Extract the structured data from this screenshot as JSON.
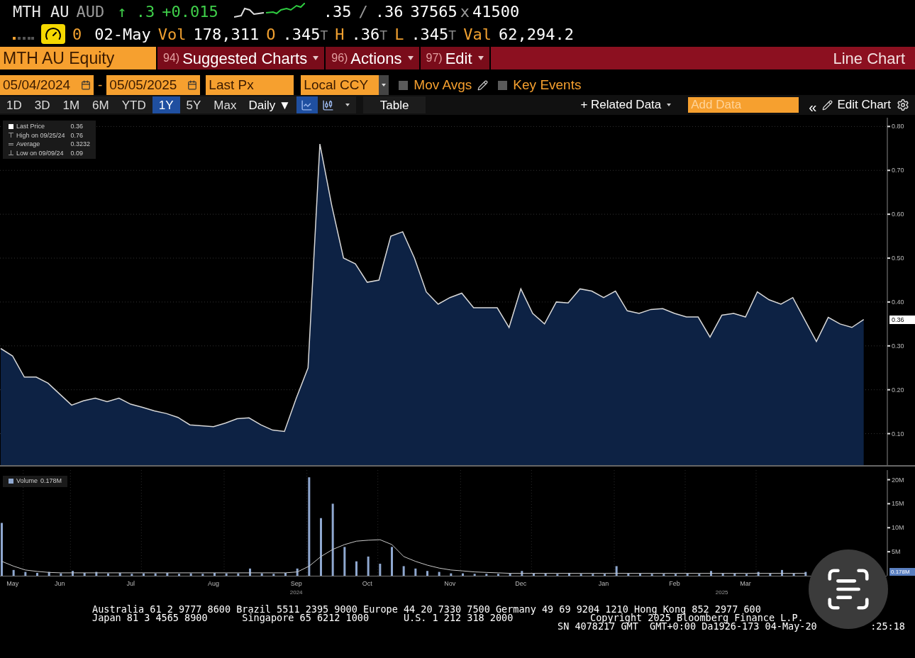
{
  "quote": {
    "ticker": "MTH AU",
    "currency": "AUD",
    "change": "↑ .3",
    "change_abs": "+0.015",
    "bid": ".35",
    "separator": "/",
    "ask": ".36",
    "bid_size": "37565",
    "size_separator": "x",
    "ask_size": "41500"
  },
  "session": {
    "count": "0",
    "date": "02-May",
    "stats": [
      {
        "label": "Vol",
        "value": "178,311"
      },
      {
        "label": "O",
        "value": ".345",
        "suffix": "T"
      },
      {
        "label": "H",
        "value": ".36",
        "suffix": "T"
      },
      {
        "label": "L",
        "value": ".345",
        "suffix": "T"
      },
      {
        "label": "Val",
        "value": "62,294.2"
      }
    ]
  },
  "command_bar": {
    "security": "MTH AU Equity",
    "menus": [
      {
        "number": "94)",
        "label": "Suggested Charts"
      },
      {
        "number": "96)",
        "label": "Actions"
      },
      {
        "number": "97)",
        "label": "Edit"
      }
    ],
    "title": "Line Chart"
  },
  "settings": {
    "start_date": "05/04/2024",
    "separator": "-",
    "end_date": "05/05/2025",
    "field": "Last Px",
    "currency": "Local CCY",
    "toggles": [
      {
        "label": "Mov Avgs",
        "checked": false,
        "editable": true
      },
      {
        "label": "Key Events",
        "checked": false,
        "editable": false
      }
    ]
  },
  "toolbar": {
    "periods": [
      {
        "label": "1D",
        "selected": false
      },
      {
        "label": "3D",
        "selected": false
      },
      {
        "label": "1M",
        "selected": false
      },
      {
        "label": "6M",
        "selected": false
      },
      {
        "label": "YTD",
        "selected": false
      },
      {
        "label": "1Y",
        "selected": true
      },
      {
        "label": "5Y",
        "selected": false
      },
      {
        "label": "Max",
        "selected": false
      }
    ],
    "frequency": "Daily ▼",
    "chart_types": [
      {
        "kind": "line",
        "selected": true
      },
      {
        "kind": "bars",
        "selected": false
      }
    ],
    "table": "Table",
    "related_data": "+ Related Data",
    "add_data_placeholder": "Add Data",
    "collapse": "«",
    "edit_chart": "Edit Chart"
  },
  "price_chart": {
    "legend": [
      {
        "kind": "last",
        "value": "0.36"
      },
      {
        "kind": "high",
        "label": "High on 09/25/24",
        "value": "0.76"
      },
      {
        "kind": "average",
        "label": "Average",
        "value": "0.3232"
      },
      {
        "kind": "low",
        "label": "Low on 09/09/24",
        "value": "0.09"
      }
    ],
    "last_tag": "0.36",
    "chart_data": {
      "type": "area",
      "grid": true,
      "ylim": [
        0.025,
        0.82
      ],
      "yticks": [
        {
          "value": 0.8,
          "label": "0.80"
        },
        {
          "value": 0.7,
          "label": "0.70"
        },
        {
          "value": 0.6,
          "label": "0.60"
        },
        {
          "value": 0.5,
          "label": "0.50"
        },
        {
          "value": 0.4,
          "label": "0.40"
        },
        {
          "value": 0.3,
          "label": "0.30"
        },
        {
          "value": 0.2,
          "label": "0.20"
        },
        {
          "value": 0.1,
          "label": "0.10"
        }
      ],
      "categories": [
        null,
        null,
        null,
        null,
        null,
        null,
        null,
        null,
        null,
        null,
        null,
        null,
        null,
        null,
        null,
        null,
        null,
        null,
        null,
        null,
        null,
        null,
        null,
        null,
        null,
        null,
        null,
        null,
        null,
        null,
        null,
        null,
        null,
        null,
        null,
        null,
        null,
        null,
        null,
        null,
        null,
        null,
        null,
        null,
        null,
        null,
        null,
        null,
        null,
        null,
        null,
        null,
        null,
        null,
        null,
        null,
        null,
        null,
        null,
        null,
        null,
        null,
        null,
        null,
        null,
        null,
        null,
        null,
        null,
        null,
        null,
        null,
        null,
        null
      ],
      "series": [
        {
          "name": "Last Price",
          "color": "#d8d8d8",
          "values": [
            0.294,
            0.277,
            0.229,
            0.229,
            0.215,
            0.19,
            0.165,
            0.175,
            0.181,
            0.173,
            0.181,
            0.167,
            0.16,
            0.152,
            0.146,
            0.137,
            0.12,
            0.118,
            0.116,
            0.124,
            0.134,
            0.136,
            0.12,
            0.108,
            0.105,
            0.181,
            0.25,
            0.76,
            0.62,
            0.5,
            0.487,
            0.445,
            0.45,
            0.55,
            0.56,
            0.5,
            0.423,
            0.395,
            0.41,
            0.42,
            0.387,
            0.387,
            0.387,
            0.342,
            0.43,
            0.374,
            0.35,
            0.4,
            0.398,
            0.43,
            0.425,
            0.41,
            0.425,
            0.38,
            0.374,
            0.383,
            0.385,
            0.374,
            0.366,
            0.366,
            0.32,
            0.37,
            0.374,
            0.366,
            0.423,
            0.405,
            0.395,
            0.41,
            0.36,
            0.31,
            0.365,
            0.35,
            0.342,
            0.36
          ]
        }
      ]
    }
  },
  "volume_chart": {
    "legend_value": "0.178M",
    "last_tag": "0.178M",
    "year_labels": [
      "2024",
      "2025"
    ],
    "chart_data": {
      "type": "bar",
      "grid": true,
      "ylim": [
        0,
        22
      ],
      "yticks": [
        {
          "value": 20,
          "label": "20M"
        },
        {
          "value": 15,
          "label": "15M"
        },
        {
          "value": 10,
          "label": "10M"
        },
        {
          "value": 5,
          "label": "5M"
        }
      ],
      "categories": [
        null,
        "May",
        null,
        null,
        null,
        "Jun",
        null,
        null,
        null,
        null,
        null,
        "Jul",
        null,
        null,
        null,
        null,
        null,
        null,
        "Aug",
        null,
        null,
        null,
        null,
        null,
        null,
        "Sep",
        null,
        null,
        null,
        null,
        null,
        "Oct",
        null,
        null,
        null,
        null,
        null,
        null,
        "Nov",
        null,
        null,
        null,
        null,
        null,
        "Dec",
        null,
        null,
        null,
        null,
        null,
        null,
        "Jan",
        null,
        null,
        null,
        null,
        null,
        "Feb",
        null,
        null,
        null,
        null,
        null,
        "Mar",
        null,
        null,
        null,
        null,
        null
      ],
      "series": [
        {
          "name": "Volume",
          "type": "bar",
          "color": "#8fa8d0",
          "values": [
            11,
            1.2,
            0.8,
            0.6,
            0.8,
            0.5,
            1,
            0.6,
            0.8,
            0.5,
            0.6,
            0.4,
            0.5,
            0.5,
            0.6,
            0.4,
            0.5,
            0.4,
            0.6,
            0.5,
            0.5,
            1.5,
            0.5,
            0.4,
            0.6,
            1.5,
            20.5,
            12,
            15,
            6,
            3,
            4,
            2.5,
            6,
            2,
            1.5,
            1,
            0.8,
            0.5,
            0.5,
            0.4,
            0.4,
            0.4,
            0.5,
            1,
            0.5,
            0.5,
            0.4,
            0.6,
            0.4,
            0.4,
            0.4,
            2,
            0.5,
            0.5,
            0.4,
            0.4,
            0.4,
            0.5,
            0.4,
            1,
            0.5,
            0.5,
            0.4,
            0.8,
            0.5,
            1.2,
            0.5,
            0.8
          ]
        },
        {
          "type": "line",
          "color": "#c8c8c8",
          "values": [
            3,
            2,
            1.2,
            0.9,
            0.7,
            0.6,
            0.6,
            0.6,
            0.6,
            0.6,
            0.6,
            0.6,
            0.6,
            0.6,
            0.6,
            0.6,
            0.6,
            0.6,
            0.6,
            0.6,
            0.6,
            0.6,
            0.6,
            0.6,
            0.6,
            0.8,
            2,
            4,
            5.5,
            6.5,
            7.2,
            7.4,
            7.5,
            6.5,
            4,
            3,
            2.2,
            1.6,
            1.2,
            1,
            0.8,
            0.7,
            0.6,
            0.5,
            0.5,
            0.5,
            0.5,
            0.5,
            0.5,
            0.5,
            0.5,
            0.5,
            0.5,
            0.5,
            0.5,
            0.5,
            0.5,
            0.5,
            0.5,
            0.5,
            0.5,
            0.5,
            0.5,
            0.5,
            0.5,
            0.5,
            0.5,
            0.5,
            0.5
          ]
        }
      ]
    }
  },
  "footer": {
    "contacts": [
      "Australia 61 2 9777 8600 Brazil 5511 2395 9000 Europe 44 20 7330 7500 Germany 49 69 9204 1210 Hong Kong 852 2977 600",
      "Japan 81 3 4565 8900      Singapore 65 6212 1000      U.S. 1 212 318 2000"
    ],
    "copyright": "Copyright 2025 Bloomberg Finance L.P.",
    "session_id": "SN 4078217 GMT  GMT+0:00 Da1926-173 04-May-20",
    "time": ":25:18"
  }
}
